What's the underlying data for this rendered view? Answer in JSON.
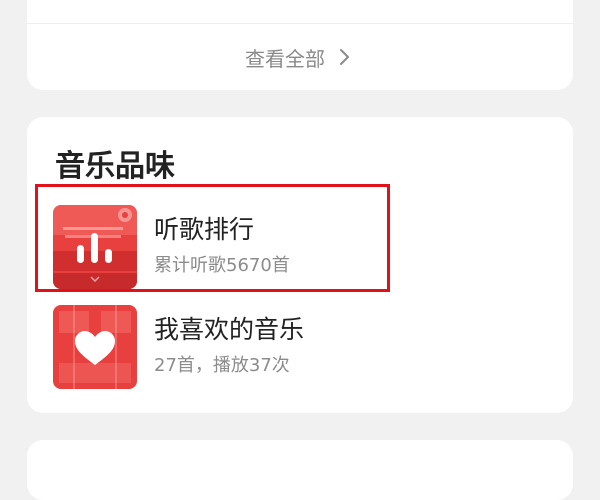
{
  "top_card": {
    "view_all_label": "查看全部"
  },
  "music_taste": {
    "title": "音乐品味",
    "items": [
      {
        "title": "听歌排行",
        "subtitle": "累计听歌5670首",
        "icon": "bar-chart-icon"
      },
      {
        "title": "我喜欢的音乐",
        "subtitle": "27首，播放37次",
        "icon": "heart-icon"
      }
    ]
  },
  "colors": {
    "accent": "#e0111a",
    "cover_red": "#e8403f",
    "background": "#f1f1f1"
  }
}
